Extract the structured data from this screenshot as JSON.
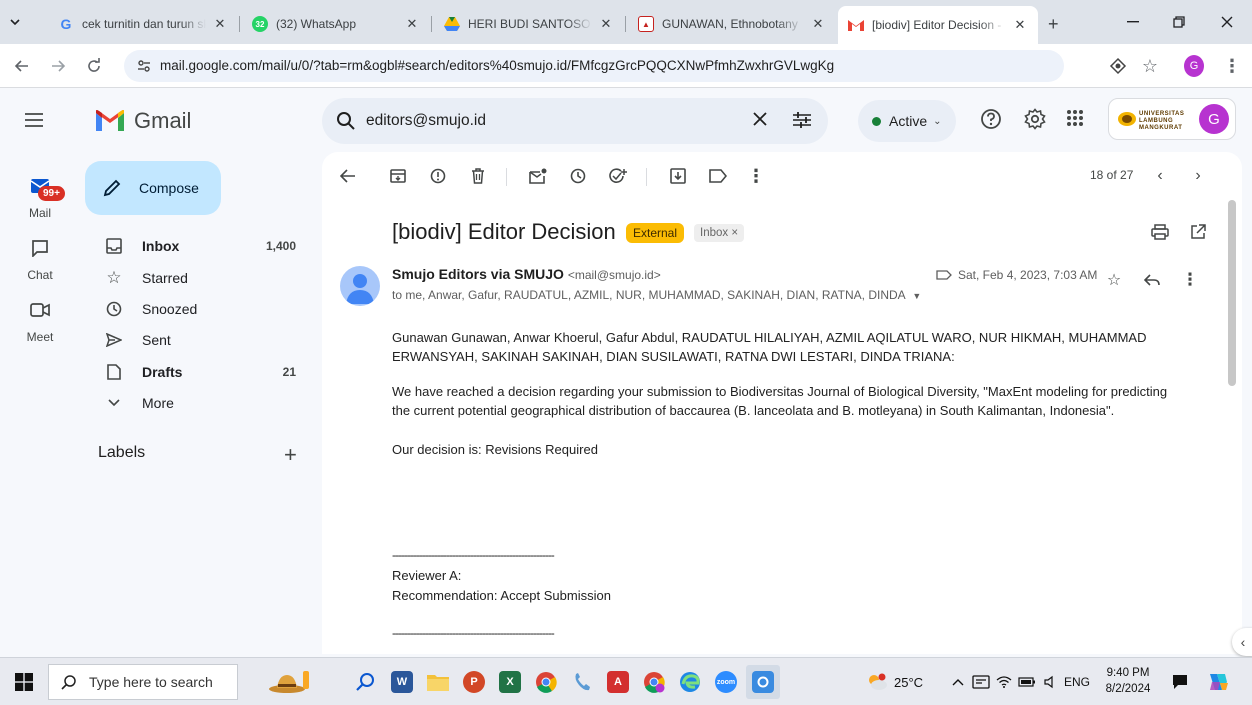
{
  "browser": {
    "tabs": [
      {
        "title": "cek turnitin dan turun skor",
        "favicon": "G"
      },
      {
        "title": "(32) WhatsApp",
        "favicon": "32"
      },
      {
        "title": "HERI BUDI SANTOSO - Google Drive",
        "favicon": "drive"
      },
      {
        "title": "GUNAWAN, Ethnobotany",
        "favicon": "ulm"
      },
      {
        "title": "[biodiv] Editor Decision - ",
        "favicon": "M"
      }
    ],
    "new_tab_label": "+",
    "url": "mail.google.com/mail/u/0/?tab=rm&ogbl#search/editors%40smujo.id/FMfcgzGrcPQQCXNwPfmhZwxhrGVLwgKg",
    "profile_initial": "G"
  },
  "gmail": {
    "logo_text": "Gmail",
    "search_query": "editors@smujo.id",
    "status": "Active",
    "org_badge": "UNIVERSITAS LAMBUNG MANGKURAT",
    "avatar_initial": "G"
  },
  "rail": {
    "items": [
      {
        "label": "Mail"
      },
      {
        "label": "Chat"
      },
      {
        "label": "Meet"
      }
    ],
    "mail_badge": "99+"
  },
  "nav": {
    "compose_label": "Compose",
    "items": [
      {
        "label": "Inbox",
        "count": "1,400"
      },
      {
        "label": "Starred",
        "count": ""
      },
      {
        "label": "Snoozed",
        "count": ""
      },
      {
        "label": "Sent",
        "count": ""
      },
      {
        "label": "Drafts",
        "count": "21"
      },
      {
        "label": "More",
        "count": ""
      }
    ],
    "labels_heading": "Labels",
    "labels_add": "+"
  },
  "message": {
    "pager": "18 of 27",
    "subject": "[biodiv] Editor Decision",
    "tag_external": "External",
    "tag_inbox": "Inbox",
    "tag_inbox_close": "×",
    "sender_name": "Smujo Editors via SMUJO",
    "sender_email": "<mail@smujo.id>",
    "recipients": "to me, Anwar, Gafur, RAUDATUL, AZMIL, NUR, MUHAMMAD, SAKINAH, DIAN, RATNA, DINDA",
    "date": "Sat, Feb 4, 2023, 7:03 AM",
    "body": {
      "greeting": "Gunawan Gunawan, Anwar Khoerul, Gafur Abdul, RAUDATUL HILALIYAH, AZMIL AQILATUL WARO, NUR HIKMAH, MUHAMMAD ERWANSYAH, SAKINAH SAKINAH, DIAN SUSILAWATI, RATNA DWI LESTARI, DINDA TRIANA:",
      "paragraph1": "We have reached a decision regarding your submission to Biodiversitas Journal of Biological Diversity, \"MaxEnt modeling for predicting the current potential geographical distribution of baccaurea (B. lanceolata and B. motleyana) in South Kalimantan, Indonesia\".",
      "decision": "Our decision is: Revisions Required",
      "separator": "------------------------------------------------------",
      "reviewer": "Reviewer A:",
      "recommendation": "Recommendation: Accept Submission",
      "separator2": "------------------------------------------------------"
    }
  },
  "taskbar": {
    "search_placeholder": "Type here to search",
    "temperature": "25°C",
    "language": "ENG",
    "time": "9:40 PM",
    "date": "8/2/2024"
  },
  "colors": {
    "accent": "#0b57d0",
    "compose_bg": "#c2e7ff",
    "external_tag": "#fbbc04",
    "active_dot": "#188038",
    "badge_red": "#d93025"
  }
}
